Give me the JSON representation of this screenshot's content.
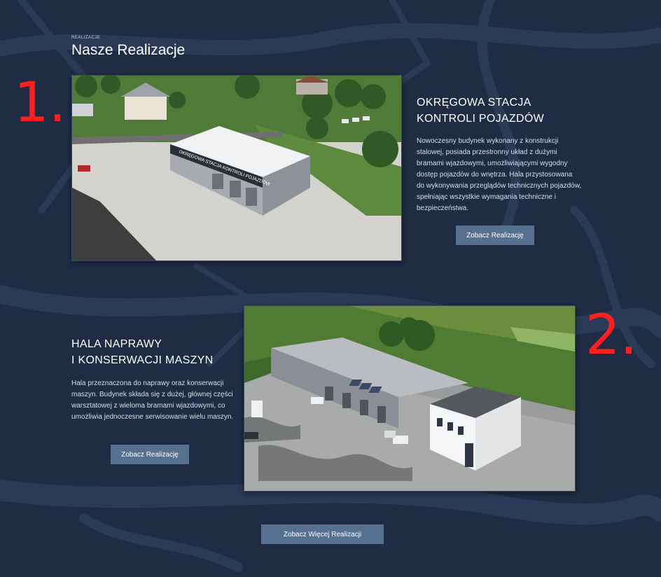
{
  "section": {
    "eyebrow": "Realizacje",
    "title": "Nasze Realizacje"
  },
  "projects": [
    {
      "title_line1": "OKRĘGOWA STACJA",
      "title_line2": "KONTROLI POJAZDÓW",
      "description": "Nowoczesny budynek wykonany z konstrukcji stalowej, posiada przestronny układ z dużymi bramami wjazdowymi, umożliwiającymi wygodny dostęp pojazdów do wnętrza. Hala przystosowana do wykonywania przeglądów technicznych pojazdów, spełniając wszystkie wymagania techniczne i bezpieczeństwa.",
      "button": "Zobacz Realizację",
      "photo_sign": "OKRĘGOWA STACJA KONTROLI POJAZDÓW",
      "marker": "1."
    },
    {
      "title_line1": "HALA NAPRAWY",
      "title_line2": "I KONSERWACJI MASZYN",
      "description": "Hala przeznaczona do naprawy oraz konserwacji maszyn. Budynek składa się z dużej, głównej części warsztatowej z wieloma bramami wjazdowymi, co umożliwia jednoczesne serwisowanie wielu maszyn.",
      "button": "Zobacz Realizację",
      "marker": "2."
    }
  ],
  "more_button": "Zobacz Więcej Realizacji",
  "colors": {
    "background": "#1f2c44",
    "button": "#56708f",
    "marker": "#ff1f1f"
  }
}
